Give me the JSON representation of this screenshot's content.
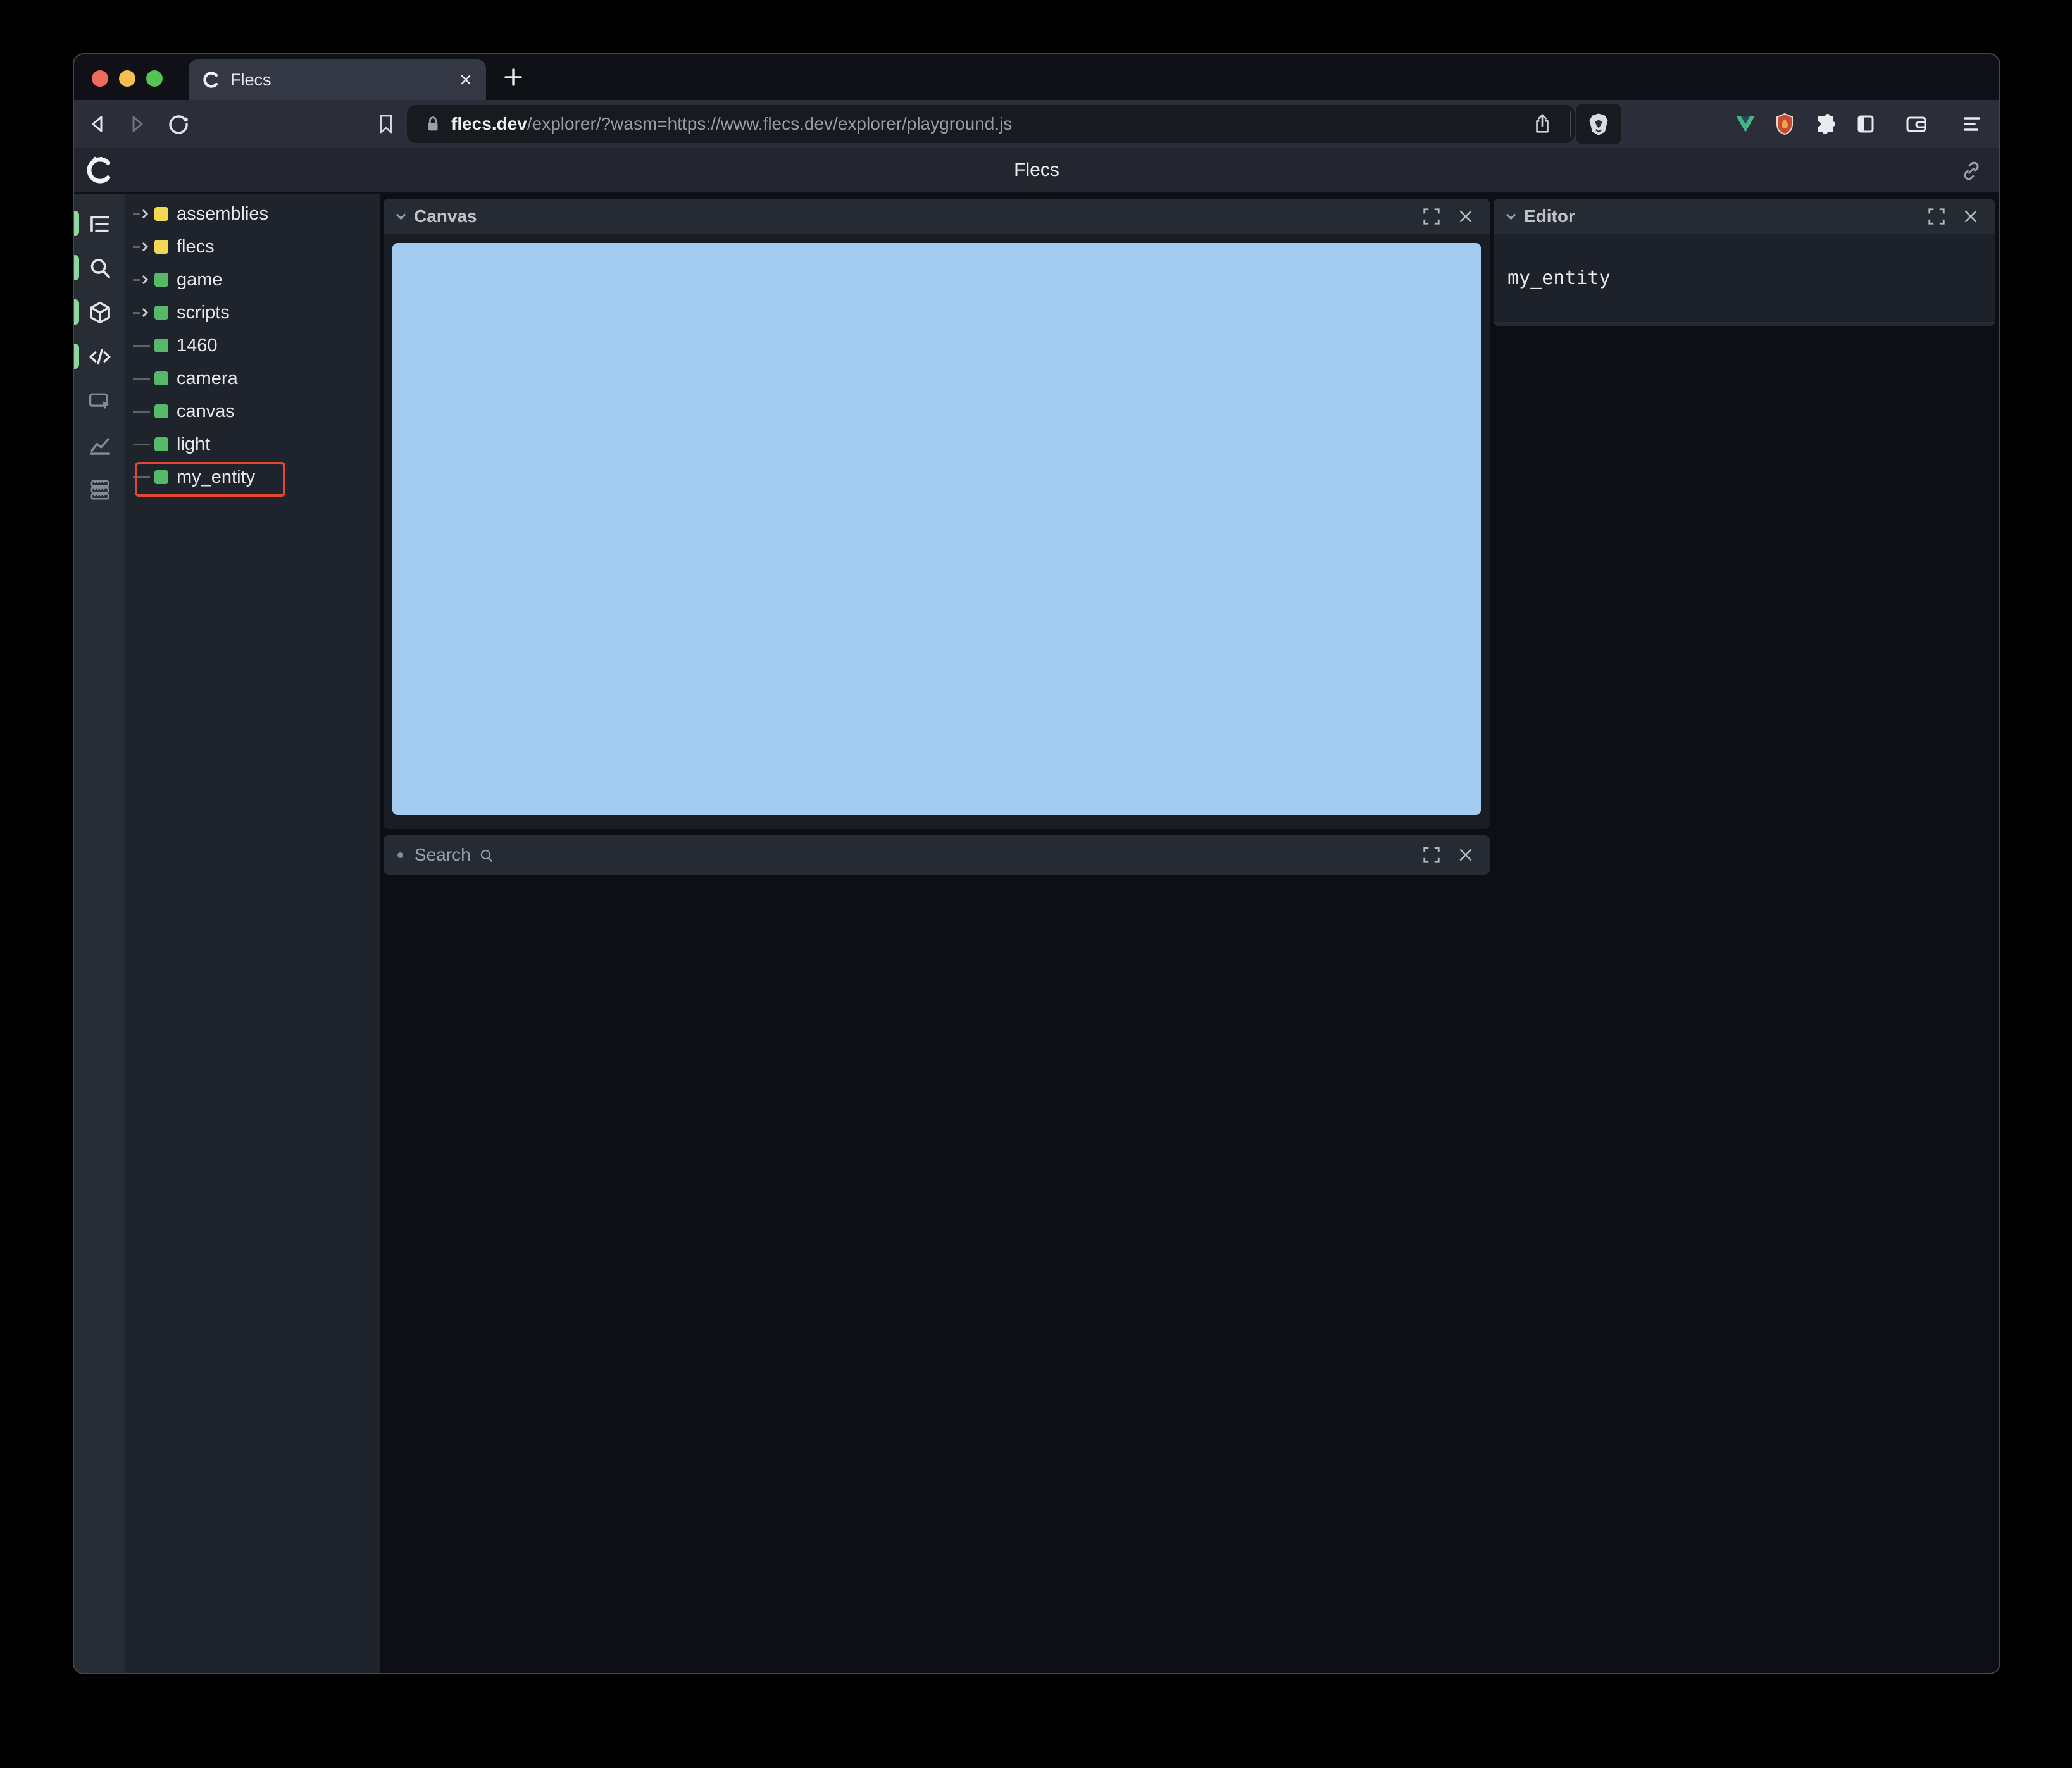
{
  "browser": {
    "traffic_lights": {
      "close": "close",
      "minimize": "minimize",
      "zoom": "zoom"
    },
    "tab": {
      "title": "Flecs"
    },
    "url": {
      "host": "flecs.dev",
      "path": "/explorer/?wasm=https://www.flecs.dev/explorer/playground.js"
    }
  },
  "app": {
    "header": {
      "title": "Flecs"
    },
    "rail": {
      "items": [
        {
          "name": "tree",
          "active": true
        },
        {
          "name": "query",
          "active": true
        },
        {
          "name": "canvas",
          "active": true
        },
        {
          "name": "editor",
          "active": true
        },
        {
          "name": "inspect",
          "active": false
        },
        {
          "name": "stats",
          "active": false
        },
        {
          "name": "memory",
          "active": false
        }
      ]
    },
    "tree": {
      "items": [
        {
          "label": "assemblies",
          "color": "#f2d750",
          "expandable": true
        },
        {
          "label": "flecs",
          "color": "#f2d750",
          "expandable": true
        },
        {
          "label": "game",
          "color": "#56b96a",
          "expandable": true
        },
        {
          "label": "scripts",
          "color": "#56b96a",
          "expandable": true
        },
        {
          "label": "1460",
          "color": "#56b96a",
          "expandable": false
        },
        {
          "label": "camera",
          "color": "#56b96a",
          "expandable": false
        },
        {
          "label": "canvas",
          "color": "#56b96a",
          "expandable": false
        },
        {
          "label": "light",
          "color": "#56b96a",
          "expandable": false
        },
        {
          "label": "my_entity",
          "color": "#56b96a",
          "expandable": false,
          "annotated": true
        }
      ]
    },
    "panels": {
      "canvas": {
        "title": "Canvas",
        "surface_color": "#a3cbf0"
      },
      "search": {
        "title": "Search"
      },
      "editor": {
        "title": "Editor",
        "content": "my_entity"
      }
    },
    "annotation_color": "#e0492e"
  }
}
